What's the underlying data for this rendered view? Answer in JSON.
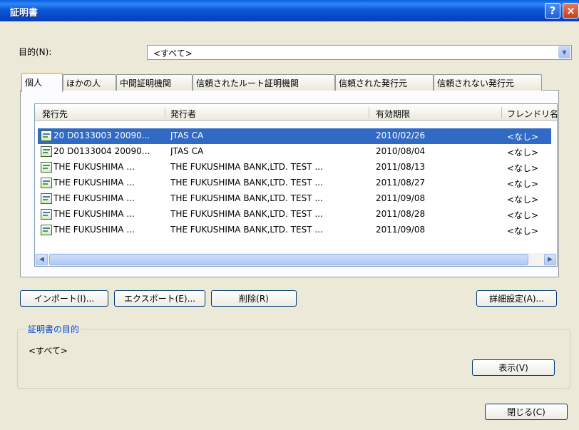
{
  "window": {
    "title": "証明書",
    "help_glyph": "?",
    "close_glyph": "×"
  },
  "purpose": {
    "label": "目的(N):",
    "value": "<すべて>"
  },
  "tabs": [
    {
      "label": "個人",
      "active": true
    },
    {
      "label": "ほかの人",
      "active": false
    },
    {
      "label": "中間証明機関",
      "active": false
    },
    {
      "label": "信頼されたルート証明機関",
      "active": false
    },
    {
      "label": "信頼された発行元",
      "active": false
    },
    {
      "label": "信頼されない発行元",
      "active": false
    }
  ],
  "list": {
    "columns": [
      "発行先",
      "発行者",
      "有効期限",
      "フレンドリ名"
    ],
    "rows": [
      {
        "issued_to": "20 D0133003 20090...",
        "issued_by": "JTAS CA",
        "expires": "2010/02/26",
        "friendly": "<なし>",
        "selected": true
      },
      {
        "issued_to": "20 D0133004 20090...",
        "issued_by": "JTAS CA",
        "expires": "2010/08/04",
        "friendly": "<なし>"
      },
      {
        "issued_to": "THE FUKUSHIMA ...",
        "issued_by": "THE FUKUSHIMA BANK,LTD. TEST ...",
        "expires": "2011/08/13",
        "friendly": "<なし>"
      },
      {
        "issued_to": "THE FUKUSHIMA ...",
        "issued_by": "THE FUKUSHIMA BANK,LTD. TEST ...",
        "expires": "2011/08/27",
        "friendly": "<なし>"
      },
      {
        "issued_to": "THE FUKUSHIMA ...",
        "issued_by": "THE FUKUSHIMA BANK,LTD. TEST ...",
        "expires": "2011/09/08",
        "friendly": "<なし>"
      },
      {
        "issued_to": "THE FUKUSHIMA ...",
        "issued_by": "THE FUKUSHIMA BANK,LTD. TEST ...",
        "expires": "2011/08/28",
        "friendly": "<なし>"
      },
      {
        "issued_to": "THE FUKUSHIMA ...",
        "issued_by": "THE FUKUSHIMA BANK,LTD. TEST ...",
        "expires": "2011/09/08",
        "friendly": "<なし>"
      }
    ]
  },
  "buttons": {
    "import": "インポート(I)...",
    "export": "エクスポート(E)...",
    "delete": "削除(R)",
    "advanced": "詳細設定(A)...",
    "view": "表示(V)",
    "close": "閉じる(C)"
  },
  "purpose_group": {
    "title": "証明書の目的",
    "value": "<すべて>"
  },
  "colors": {
    "selection": "#316ac5",
    "titlebar": "#0b5ad8",
    "group_title": "#0046d5"
  }
}
